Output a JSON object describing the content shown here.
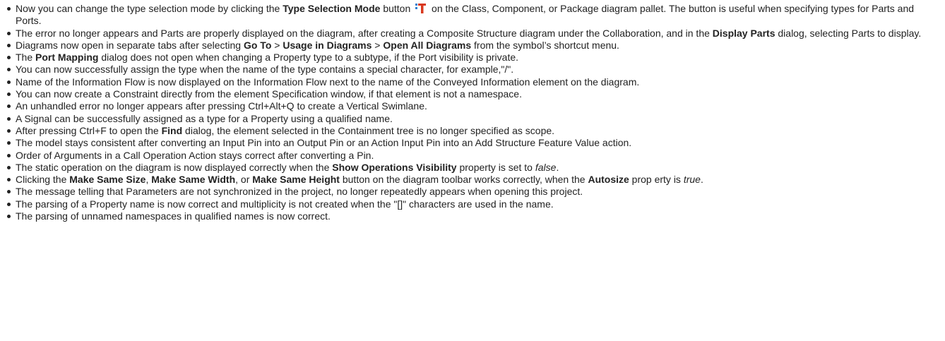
{
  "icons": {
    "type_selection_mode": "type-selection-mode-icon",
    "icon_colors": {
      "letter": "#d9381e",
      "dots": "#2f7fd0"
    }
  },
  "items": [
    [
      {
        "t": "Now you can change the type selection mode by clicking the "
      },
      {
        "t": "Type Selection Mode",
        "s": "b"
      },
      {
        "t": " button "
      },
      {
        "icon": "type_selection_mode"
      },
      {
        "t": " on the Class, Component, or Package diagram pallet. The button is useful when specifying types for Parts and Ports."
      }
    ],
    [
      {
        "t": "The error no longer appears and Parts are properly displayed on the diagram, after creating a Composite Structure diagram under the Collaboration, and in the "
      },
      {
        "t": "Display Parts",
        "s": "b"
      },
      {
        "t": " dialog, selecting Parts to display."
      }
    ],
    [
      {
        "t": "Diagrams now open in separate tabs after selecting "
      },
      {
        "t": "Go To",
        "s": "b"
      },
      {
        "t": " > "
      },
      {
        "t": "Usage in Diagrams",
        "s": "b"
      },
      {
        "t": " > "
      },
      {
        "t": "Open All Diagrams",
        "s": "b"
      },
      {
        "t": " from the symbol’s shortcut menu."
      }
    ],
    [
      {
        "t": "The "
      },
      {
        "t": "Port Mapping",
        "s": "b"
      },
      {
        "t": " dialog does not open when changing a Property type to a subtype, if the Port visibility is private."
      }
    ],
    [
      {
        "t": "You can now successfully assign the type when the name of the type contains a special character, for example,\"/\"."
      }
    ],
    [
      {
        "t": "Name of the Information Flow is now displayed on the Information Flow next to the name of the Conveyed Information element on the diagram."
      }
    ],
    [
      {
        "t": "You can now create a Constraint directly from the element Specification window, if that element is not a namespace."
      }
    ],
    [
      {
        "t": "An unhandled error no longer appears after pressing Ctrl+Alt+Q to create a Vertical Swimlane."
      }
    ],
    [
      {
        "t": "A Signal can be successfully assigned as a type for a Property using a qualified name."
      }
    ],
    [
      {
        "t": "After pressing Ctrl+F to open the "
      },
      {
        "t": "Find",
        "s": "b"
      },
      {
        "t": " dialog, the element selected in the Containment tree is no longer specified as scope."
      }
    ],
    [
      {
        "t": "The model stays consistent after converting an Input Pin into an Output Pin or an Action Input Pin into an Add Structure Feature Value action."
      }
    ],
    [
      {
        "t": "Order of Arguments in a Call Operation Action stays correct after converting a Pin."
      }
    ],
    [
      {
        "t": "The static operation on the diagram is now displayed correctly when the "
      },
      {
        "t": "Show Operations Visibility",
        "s": "b"
      },
      {
        "t": " property is set to "
      },
      {
        "t": "false",
        "s": "i"
      },
      {
        "t": "."
      }
    ],
    [
      {
        "t": "Clicking the "
      },
      {
        "t": "Make Same Size",
        "s": "b"
      },
      {
        "t": ", "
      },
      {
        "t": "Make Same Width",
        "s": "b"
      },
      {
        "t": ", or "
      },
      {
        "t": "Make Same Height",
        "s": "b"
      },
      {
        "t": " button on the diagram toolbar works correctly, when the "
      },
      {
        "t": "Autosize",
        "s": "b"
      },
      {
        "t": " prop erty is "
      },
      {
        "t": "true",
        "s": "i"
      },
      {
        "t": "."
      }
    ],
    [
      {
        "t": "The message telling that Parameters are not synchronized in the project, no longer repeatedly appears when opening this project."
      }
    ],
    [
      {
        "t": "The parsing of a Property name is now correct and multiplicity is not created when the \"[]\" characters are used in the name."
      }
    ],
    [
      {
        "t": "The parsing of unnamed namespaces in qualified names is now correct."
      }
    ]
  ]
}
